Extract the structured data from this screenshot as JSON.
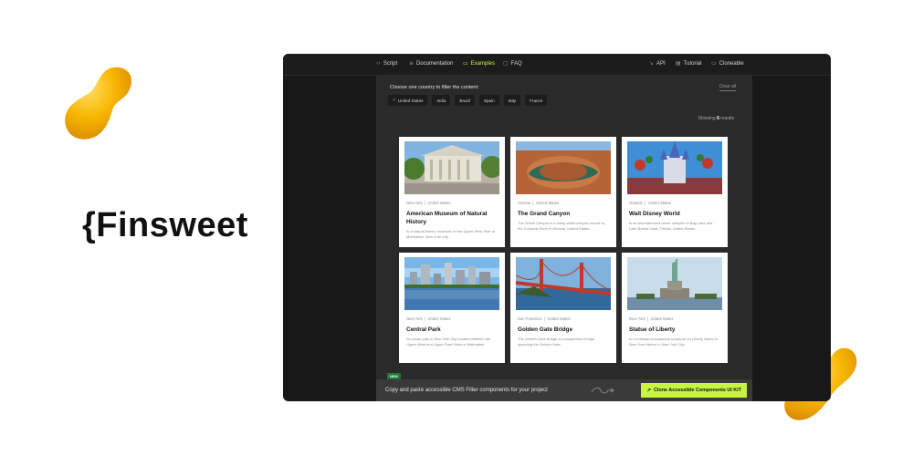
{
  "brand": {
    "logo_text": "{Finsweet"
  },
  "nav": {
    "left": [
      {
        "label": "Script",
        "icon": "code-icon"
      },
      {
        "label": "Documentation",
        "icon": "doc-icon"
      },
      {
        "label": "Examples",
        "icon": "examples-icon",
        "active": true
      },
      {
        "label": "FAQ",
        "icon": "faq-icon"
      }
    ],
    "right": [
      {
        "label": "API",
        "icon": "api-icon"
      },
      {
        "label": "Tutorial",
        "icon": "tutorial-icon"
      },
      {
        "label": "Cloneable",
        "icon": "cloneable-icon"
      }
    ]
  },
  "filter": {
    "label": "Choose one country to filter the content:",
    "clear_all": "Clear all",
    "chips": [
      "United States",
      "India",
      "Brazil",
      "Spain",
      "Italy",
      "France"
    ],
    "selected": "United States",
    "showing_prefix": "Showing ",
    "showing_count": "6",
    "showing_suffix": " results"
  },
  "cards": [
    {
      "city": "New York",
      "country": "United States",
      "title": "American Museum of Natural History",
      "desc": "Is a natural history museum on the Upper West Side of Manhattan, New York City."
    },
    {
      "city": "Arizona",
      "country": "United States",
      "title": "The Grand Canyon",
      "desc": "The Grand Canyon is a steep-sided canyon carved by the Colorado River in Arizona, United States."
    },
    {
      "city": "Orlando",
      "country": "United States",
      "title": "Walt Disney World",
      "desc": "Is an entertainment resort complex in Bay Lake and Lake Buena Vista, Florida, United States."
    },
    {
      "city": "New York",
      "country": "United States",
      "title": "Central Park",
      "desc": "An urban park in New York City located between the Upper West and Upper East Sides of Manhattan."
    },
    {
      "city": "San Francisco",
      "country": "United States",
      "title": "Golden Gate Bridge",
      "desc": "The Golden Gate Bridge is a suspension bridge spanning the Golden Gate."
    },
    {
      "city": "New York",
      "country": "United States",
      "title": "Statue of Liberty",
      "desc": "Is a colossal neoclassical sculpture on Liberty Island in New York Harbor in New York City."
    }
  ],
  "bottom": {
    "badge": "NEW",
    "text": "Copy and paste accessible CMS Filter components for your project",
    "cta_label": "Clone Accessible Components UI KIT"
  },
  "colors": {
    "accent": "#c8f542",
    "frame": "#181818",
    "panel": "#2a2a2a",
    "blob": "#f5b400"
  }
}
